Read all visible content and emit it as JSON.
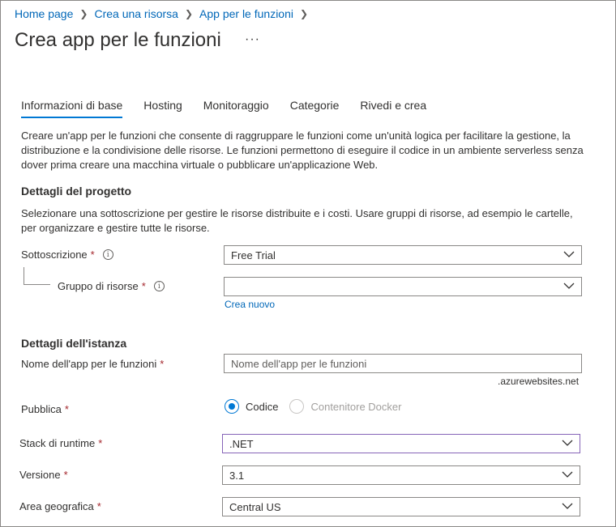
{
  "breadcrumb": [
    "Home page",
    "Crea una risorsa",
    "App per le funzioni"
  ],
  "page": {
    "title": "Crea app per le funzioni",
    "more": "···"
  },
  "tabs": [
    "Informazioni di base",
    "Hosting",
    "Monitoraggio",
    "Categorie",
    "Rivedi e crea"
  ],
  "intro": "Creare un'app per le funzioni che consente di raggruppare le funzioni come un'unità logica per facilitare la gestione, la distribuzione e la condivisione delle risorse. Le funzioni permettono di eseguire il codice in un ambiente serverless senza dover prima creare una macchina virtuale o pubblicare un'applicazione Web.",
  "project": {
    "title": "Dettagli del progetto",
    "description": "Selezionare una sottoscrizione per gestire le risorse distribuite e i costi. Usare gruppi di risorse, ad esempio le cartelle, per organizzare e gestire tutte le risorse.",
    "subscription_label": "Sottoscrizione",
    "subscription_value": "Free Trial",
    "resource_group_label": "Gruppo di risorse",
    "resource_group_value": "",
    "create_new": "Crea nuovo"
  },
  "instance": {
    "title": "Dettagli dell'istanza",
    "app_name_label": "Nome dell'app per le funzioni",
    "app_name_placeholder": "Nome dell'app per le funzioni",
    "app_name_value": "",
    "domain_suffix": ".azurewebsites.net",
    "publish_label": "Pubblica",
    "publish_options": [
      "Codice",
      "Contenitore Docker"
    ],
    "publish_selected": "Codice",
    "runtime_label": "Stack di runtime",
    "runtime_value": ".NET",
    "version_label": "Versione",
    "version_value": "3.1",
    "region_label": "Area geografica",
    "region_value": "Central US"
  },
  "required_mark": "*",
  "info_glyph": "i",
  "colors": {
    "accent": "#0078d4",
    "link": "#0067b8",
    "required": "#a4262c",
    "focus_border": "#8764b8"
  }
}
